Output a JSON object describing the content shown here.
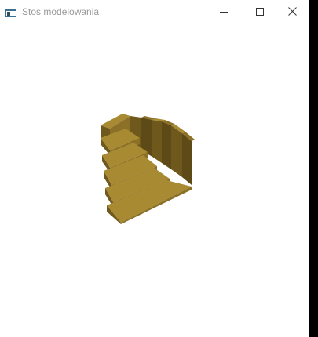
{
  "window": {
    "title": "Stos modelowania",
    "icon": "console-window-icon",
    "controls": {
      "minimize": "minimize-icon",
      "maximize": "maximize-icon",
      "close": "close-icon"
    }
  },
  "scene": {
    "object": "staircase-3d-model",
    "colors": {
      "top_face": "#a88a32",
      "front_face": "#8c7027",
      "side_face": "#5e4a17",
      "side_face_light": "#6f581c"
    }
  }
}
